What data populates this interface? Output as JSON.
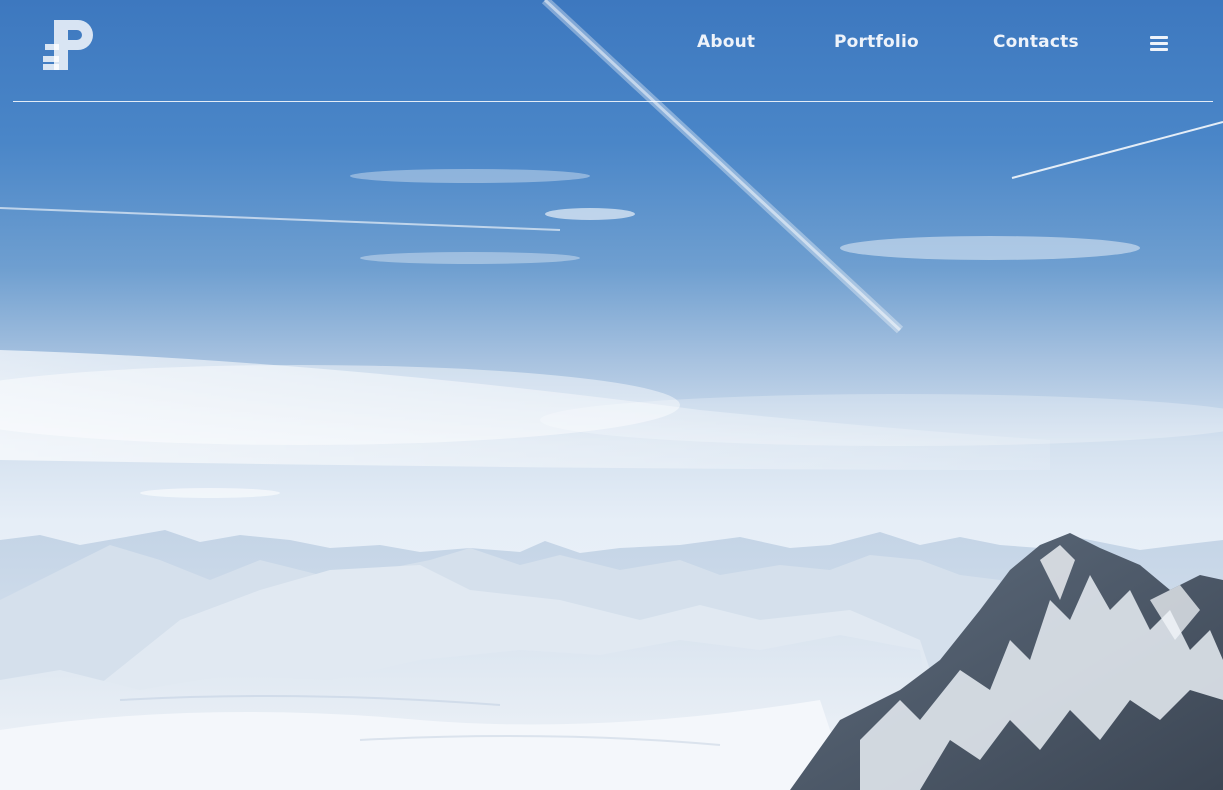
{
  "nav": {
    "logo_icon": "p-logo-icon",
    "links": [
      {
        "label": "About"
      },
      {
        "label": "Portfolio"
      },
      {
        "label": "Contacts"
      }
    ],
    "menu_icon": "hamburger-menu-icon"
  },
  "hero": {
    "image": "snowy-mountain-range-under-blue-sky",
    "sky_color": "#3d78bf",
    "snow_color": "#f4f7fb"
  }
}
